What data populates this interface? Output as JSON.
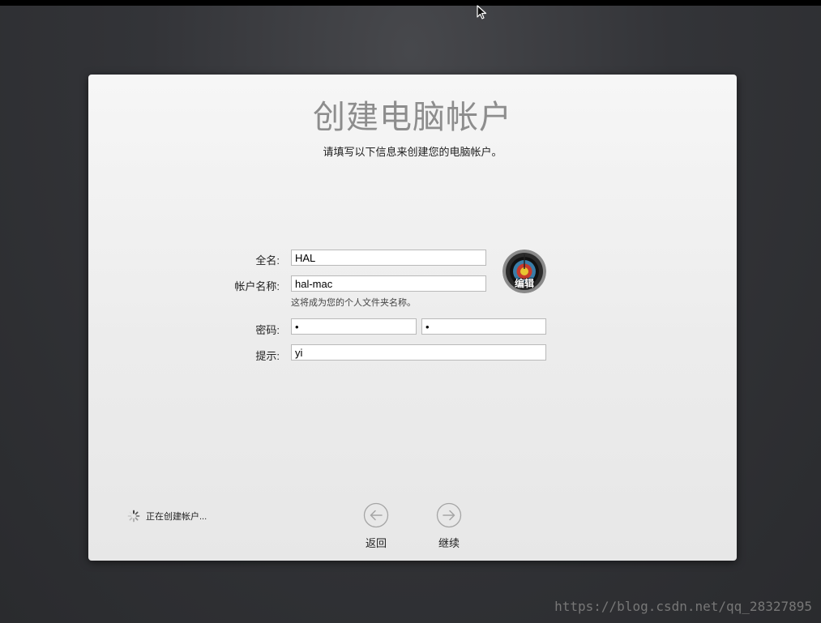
{
  "setup": {
    "title": "创建电脑帐户",
    "subtitle": "请填写以下信息来创建您的电脑帐户。"
  },
  "form": {
    "full_name": {
      "label": "全名:",
      "value": "HAL"
    },
    "account_name": {
      "label": "帐户名称:",
      "value": "hal-mac",
      "note": "这将成为您的个人文件夹名称。"
    },
    "password": {
      "label": "密码:",
      "value": "•",
      "verify_value": "•"
    },
    "hint": {
      "label": "提示:",
      "value": "yi"
    },
    "avatar": {
      "icon": "archery-target-icon",
      "edit_label": "编辑"
    }
  },
  "status": {
    "icon": "spinner-icon",
    "text": "正在创建帐户..."
  },
  "nav": {
    "back": {
      "icon": "back-arrow-circle-icon",
      "label": "返回"
    },
    "continue": {
      "icon": "forward-arrow-circle-icon",
      "label": "继续"
    }
  },
  "watermark": "https://blog.csdn.net/qq_28327895"
}
